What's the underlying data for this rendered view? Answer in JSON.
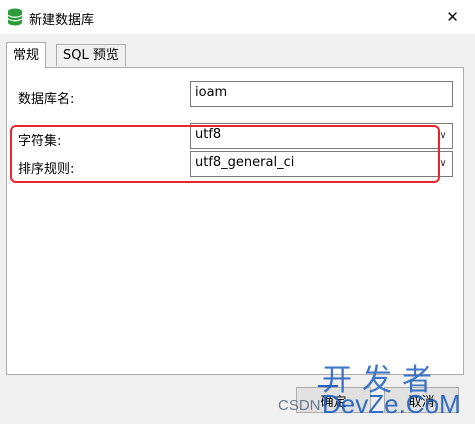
{
  "window": {
    "title": "新建数据库",
    "close_glyph": "✕"
  },
  "tabs": [
    {
      "label": "常规",
      "active": true
    },
    {
      "label": "SQL 预览",
      "active": false
    }
  ],
  "form": {
    "db_name_label": "数据库名:",
    "db_name_value": "ioam",
    "charset_label": "字符集:",
    "charset_value": "utf8",
    "collation_label": "排序规则:",
    "collation_value": "utf8_general_ci"
  },
  "buttons": {
    "ok_label": "确定",
    "cancel_label": "取消"
  },
  "watermark": {
    "big": "开发者",
    "site": "DevZe.CoM",
    "prefix": "CSDN"
  },
  "colors": {
    "highlight": "#e8262a",
    "accent": "#1f5fbf"
  }
}
